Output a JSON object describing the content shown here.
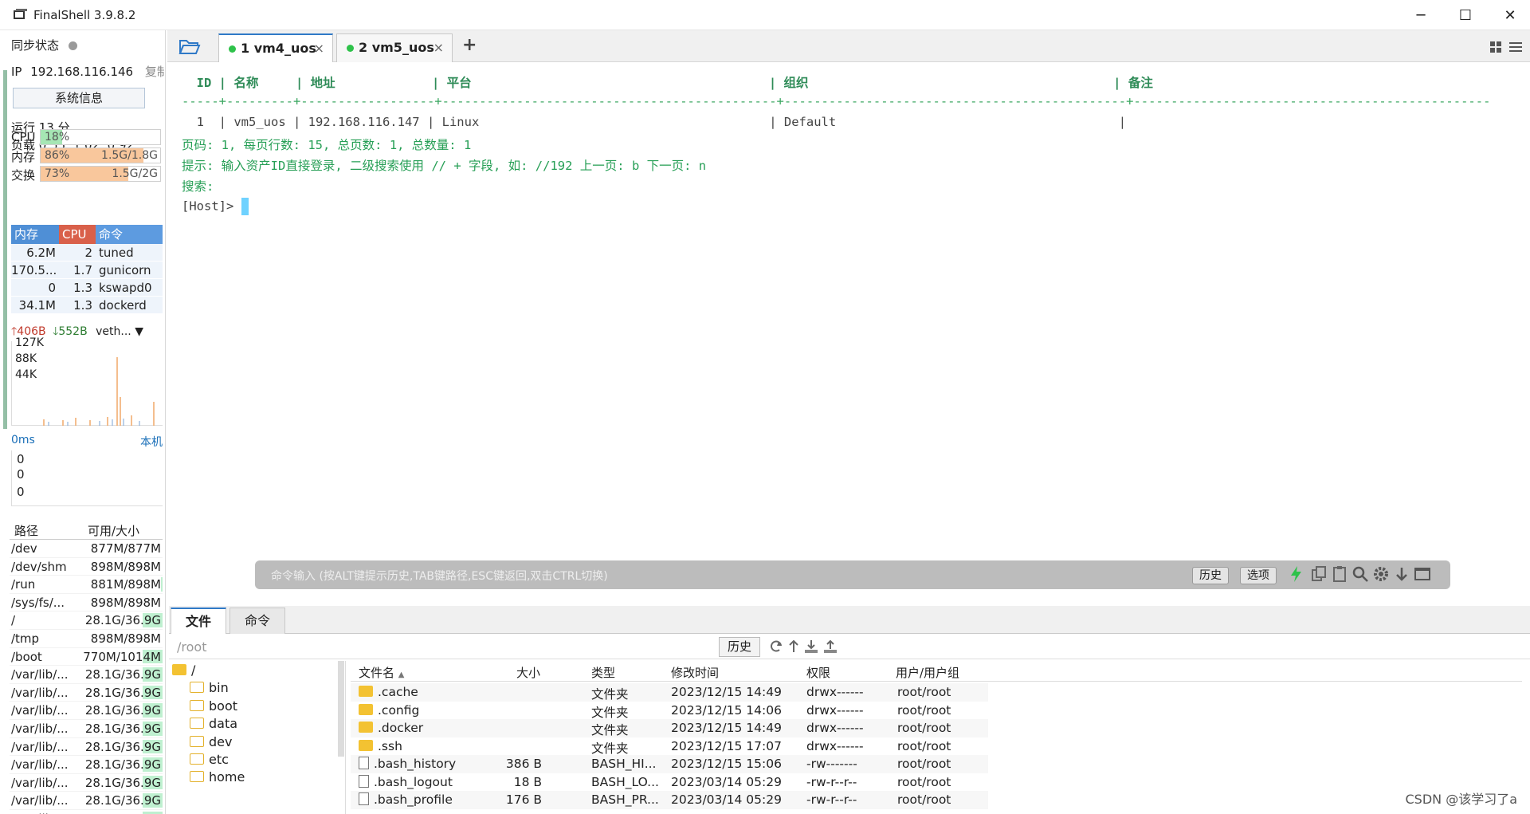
{
  "window": {
    "title": "FinalShell 3.9.8.2",
    "minimize_glyph": "─",
    "maximize_glyph": "☐",
    "close_glyph": "✕"
  },
  "sidebar": {
    "sync_label": "同步状态",
    "ip_label": "IP",
    "ip_value": "192.168.116.146",
    "copy_label": "复制",
    "sysinfo_button": "系统信息",
    "uptime": "运行 13 分",
    "load": "负载 0.55, 1.02, 0.92",
    "meters": [
      {
        "label": "CPU",
        "percent_text": "18%",
        "value_text": "",
        "fraction": 0.18,
        "color": "#a6e6b4"
      },
      {
        "label": "内存",
        "percent_text": "86%",
        "value_text": "1.5G/1.8G",
        "fraction": 0.86,
        "color": "#f9c79c"
      },
      {
        "label": "交换",
        "percent_text": "73%",
        "value_text": "1.5G/2G",
        "fraction": 0.73,
        "color": "#f9c79c"
      }
    ],
    "proc_headers": {
      "mem": "内存",
      "cpu": "CPU",
      "cmd": "命令"
    },
    "proc_colors": {
      "mem": "#4f8fd6",
      "cpu": "#d9604a",
      "cmd": "#5d9be0"
    },
    "processes": [
      {
        "mem": "6.2M",
        "cpu": "2",
        "cmd": "tuned"
      },
      {
        "mem": "170.5...",
        "cpu": "1.7",
        "cmd": "gunicorn"
      },
      {
        "mem": "0",
        "cpu": "1.3",
        "cmd": "kswapd0"
      },
      {
        "mem": "34.1M",
        "cpu": "1.3",
        "cmd": "dockerd"
      }
    ],
    "net_up": "406B",
    "net_down": "552B",
    "net_iface": "veth...",
    "net_scale": [
      "127K",
      "88K",
      "44K"
    ],
    "ping_label": "0ms",
    "ping_target": "本机",
    "ping_scale": [
      "0",
      "0",
      "0"
    ],
    "disk_headers": {
      "path": "路径",
      "size": "可用/大小"
    },
    "disks": [
      {
        "path": "/dev",
        "size": "877M/877M",
        "used": 0.0
      },
      {
        "path": "/dev/shm",
        "size": "898M/898M",
        "used": 0.0
      },
      {
        "path": "/run",
        "size": "881M/898M",
        "used": 0.02
      },
      {
        "path": "/sys/fs/...",
        "size": "898M/898M",
        "used": 0.0
      },
      {
        "path": "/",
        "size": "28.1G/36.9G",
        "used": 0.24
      },
      {
        "path": "/tmp",
        "size": "898M/898M",
        "used": 0.0
      },
      {
        "path": "/boot",
        "size": "770M/1014M",
        "used": 0.24
      },
      {
        "path": "/var/lib/...",
        "size": "28.1G/36.9G",
        "used": 0.24
      },
      {
        "path": "/var/lib/...",
        "size": "28.1G/36.9G",
        "used": 0.24
      },
      {
        "path": "/var/lib/...",
        "size": "28.1G/36.9G",
        "used": 0.24
      },
      {
        "path": "/var/lib/...",
        "size": "28.1G/36.9G",
        "used": 0.24
      },
      {
        "path": "/var/lib/...",
        "size": "28.1G/36.9G",
        "used": 0.24
      },
      {
        "path": "/var/lib/...",
        "size": "28.1G/36.9G",
        "used": 0.24
      },
      {
        "path": "/var/lib/...",
        "size": "28.1G/36.9G",
        "used": 0.24
      },
      {
        "path": "/var/lib/...",
        "size": "28.1G/36.9G",
        "used": 0.24
      },
      {
        "path": "/var/lib/...",
        "size": "28.1G/36.9G",
        "used": 0.24
      }
    ]
  },
  "tabs": [
    {
      "label": "1 vm4_uos",
      "active": true
    },
    {
      "label": "2 vm5_uos",
      "active": false
    }
  ],
  "terminal": {
    "header_line": "  ID | 名称     | 地址             | 平台                                        | 组织                                         | 备注",
    "separator_line": "-----+---------+------------------+---------------------------------------------+----------------------------------------------+------------------------------------------------",
    "row_line": "  1  | vm5_uos | 192.168.116.147 | Linux                                       | Default                                      |",
    "page_info": "页码: 1, 每页行数: 15, 总页数: 1, 总数量: 1",
    "hint": "提示: 输入资产ID直接登录, 二级搜索使用 // + 字段, 如: //192 上一页: b 下一页: n",
    "search": "搜索:",
    "prompt": "[Host]> "
  },
  "command_bar": {
    "placeholder": "命令输入 (按ALT键提示历史,TAB键路径,ESC键返回,双击CTRL切换)",
    "history_button": "历史",
    "options_button": "选项"
  },
  "bottom_tabs": [
    {
      "label": "文件",
      "active": true
    },
    {
      "label": "命令",
      "active": false
    }
  ],
  "file_browser": {
    "path": "/root",
    "history_button": "历史",
    "tree": [
      {
        "name": "/",
        "depth": 0
      },
      {
        "name": "bin",
        "depth": 1
      },
      {
        "name": "boot",
        "depth": 1
      },
      {
        "name": "data",
        "depth": 1
      },
      {
        "name": "dev",
        "depth": 1
      },
      {
        "name": "etc",
        "depth": 1
      },
      {
        "name": "home",
        "depth": 1
      }
    ],
    "columns": {
      "name": "文件名",
      "size": "大小",
      "type": "类型",
      "mtime": "修改时间",
      "perm": "权限",
      "owner": "用户/用户组"
    },
    "sort_glyph": "▲",
    "files": [
      {
        "name": ".cache",
        "size": "",
        "type": "文件夹",
        "mtime": "2023/12/15 14:49",
        "perm": "drwx------",
        "owner": "root/root",
        "kind": "folder"
      },
      {
        "name": ".config",
        "size": "",
        "type": "文件夹",
        "mtime": "2023/12/15 14:06",
        "perm": "drwx------",
        "owner": "root/root",
        "kind": "folder"
      },
      {
        "name": ".docker",
        "size": "",
        "type": "文件夹",
        "mtime": "2023/12/15 14:49",
        "perm": "drwx------",
        "owner": "root/root",
        "kind": "folder"
      },
      {
        "name": ".ssh",
        "size": "",
        "type": "文件夹",
        "mtime": "2023/12/15 17:07",
        "perm": "drwx------",
        "owner": "root/root",
        "kind": "folder"
      },
      {
        "name": ".bash_history",
        "size": "386 B",
        "type": "BASH_HI...",
        "mtime": "2023/12/15 15:06",
        "perm": "-rw-------",
        "owner": "root/root",
        "kind": "file"
      },
      {
        "name": ".bash_logout",
        "size": "18 B",
        "type": "BASH_LO...",
        "mtime": "2023/03/14 05:29",
        "perm": "-rw-r--r--",
        "owner": "root/root",
        "kind": "file"
      },
      {
        "name": ".bash_profile",
        "size": "176 B",
        "type": "BASH_PR...",
        "mtime": "2023/03/14 05:29",
        "perm": "-rw-r--r--",
        "owner": "root/root",
        "kind": "file"
      }
    ]
  },
  "watermark": "CSDN @该学习了a"
}
